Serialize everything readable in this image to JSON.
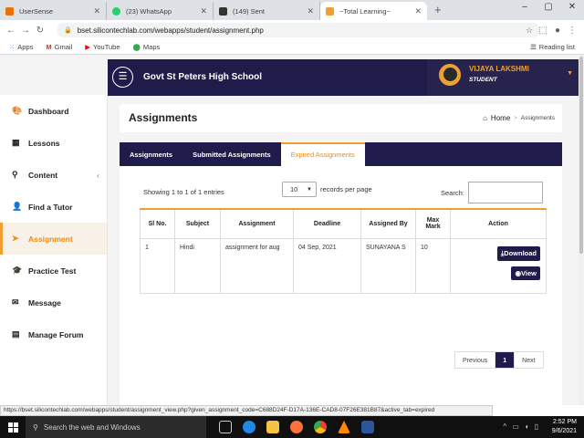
{
  "browser": {
    "tabs": [
      {
        "label": "UserSense",
        "color": "#e8710a"
      },
      {
        "label": "(23) WhatsApp",
        "color": "#25d366"
      },
      {
        "label": "(149) Sent",
        "color": "#333333"
      },
      {
        "label": "~Total Learning~",
        "color": "#f0a030"
      }
    ],
    "url": "bset.silicontechlab.com/webapps/student/assignment.php",
    "bookmarks": [
      "Apps",
      "Gmail",
      "YouTube",
      "Maps"
    ],
    "reading_list": "Reading list"
  },
  "header": {
    "school": "Govt St Peters High School",
    "user_name": "VIJAYA LAKSHMI",
    "user_role": "STUDENT"
  },
  "sidebar": {
    "items": [
      {
        "label": "Dashboard",
        "icon": "palette-icon"
      },
      {
        "label": "Lessons",
        "icon": "calendar-icon"
      },
      {
        "label": "Content",
        "icon": "search-icon"
      },
      {
        "label": "Find a Tutor",
        "icon": "person-icon"
      },
      {
        "label": "Assignment",
        "icon": "send-icon"
      },
      {
        "label": "Practice Test",
        "icon": "graduation-cap-icon"
      },
      {
        "label": "Message",
        "icon": "envelope-icon"
      },
      {
        "label": "Manage Forum",
        "icon": "document-icon"
      }
    ],
    "active": "Assignment"
  },
  "page": {
    "title": "Assignments",
    "breadcrumb_home": "Home",
    "breadcrumb_current": "Assignments"
  },
  "tabs": [
    "Assignments",
    "Submitted Assignments",
    "Expired Assignments"
  ],
  "selected_tab": "Expired Assignments",
  "table_controls": {
    "showing": "Showing 1 to 1 of 1 entries",
    "length_value": "10",
    "records_label": "records per page",
    "search_label": "Search:"
  },
  "table": {
    "headers": [
      "Sl No.",
      "Subject",
      "Assignment",
      "Deadline",
      "Assigned By",
      "Max Mark",
      "Action"
    ],
    "rows": [
      {
        "sl": "1",
        "subject": "Hindi",
        "assignment": "assignment for aug",
        "deadline": "04 Sep, 2021",
        "assigned_by": "SUNAYANA S",
        "max_mark": "10",
        "download": "Download",
        "view": "View"
      }
    ]
  },
  "pagination": {
    "prev": "Previous",
    "current": "1",
    "next": "Next"
  },
  "status_url": "https://bset.silicontechlab.com/webapps/student/assignment_view.php?given_assignment_code=C688D24F-D17A-136E-CAD8-07F26E381B87&active_tab=expired",
  "taskbar": {
    "search": "Search the web and Windows",
    "time": "2:52 PM",
    "date": "9/6/2021"
  },
  "colors": {
    "navy": "#1f1b4b",
    "accent": "#f0a030"
  }
}
